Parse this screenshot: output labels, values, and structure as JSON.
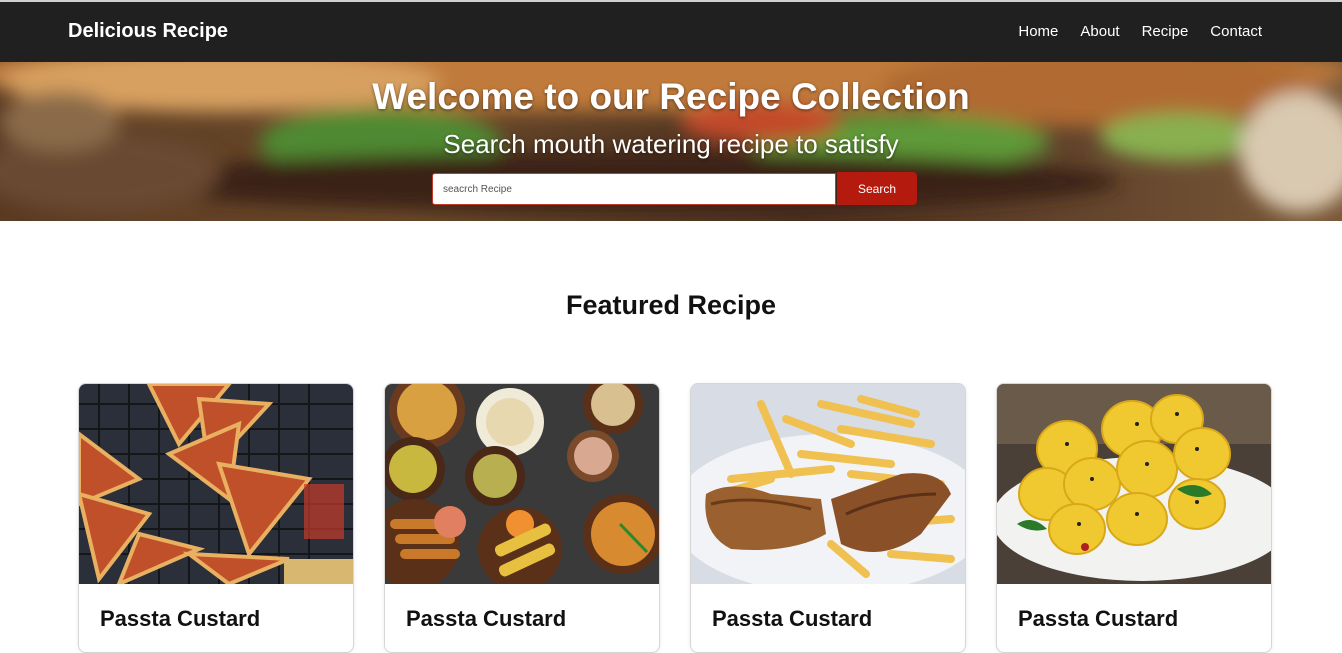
{
  "navbar": {
    "brand": "Delicious Recipe",
    "links": [
      "Home",
      "About",
      "Recipe",
      "Contact"
    ]
  },
  "hero": {
    "title": "Welcome to our Recipe Collection",
    "subtitle": "Search mouth watering recipe to satisfy",
    "search_placeholder": "seacrch Recipe",
    "search_button": "Search"
  },
  "featured": {
    "title": "Featured Recipe",
    "cards": [
      {
        "title": "Passta Custard",
        "image": "pizza-toast-image"
      },
      {
        "title": "Passta Custard",
        "image": "indian-snacks-image"
      },
      {
        "title": "Passta Custard",
        "image": "fries-fish-image"
      },
      {
        "title": "Passta Custard",
        "image": "khandvi-image"
      }
    ]
  },
  "colors": {
    "navbar": "#202020",
    "search_button": "#b51a0f",
    "text": "#111111"
  }
}
